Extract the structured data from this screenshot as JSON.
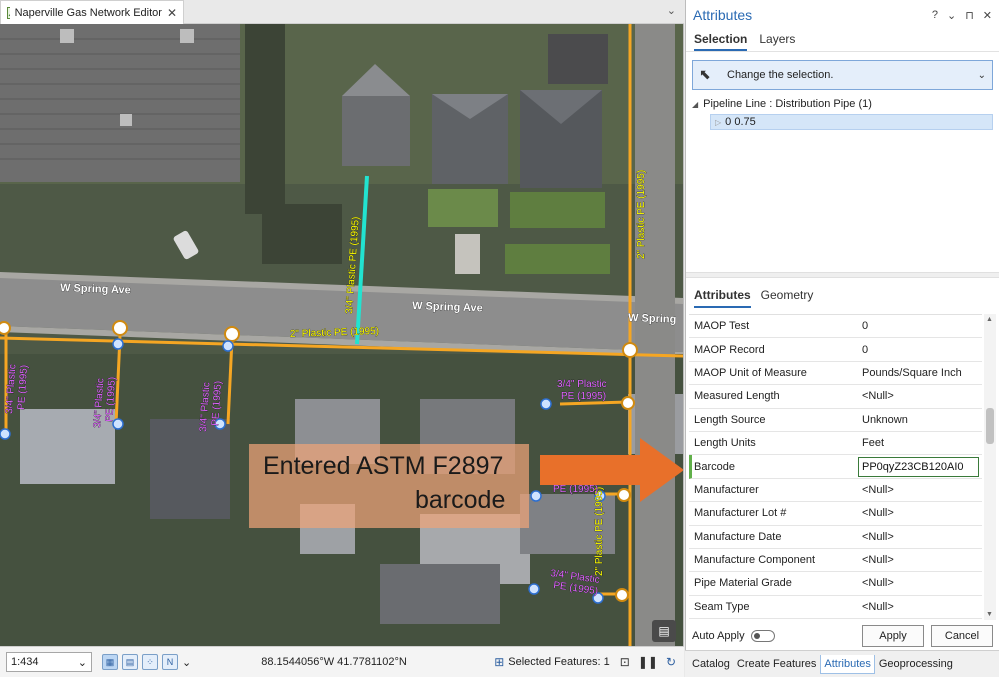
{
  "map_tab": {
    "title": "Naperville Gas Network Editor",
    "close": "✕"
  },
  "map": {
    "streets": [
      "W Spring Ave",
      "W Spring Ave",
      "W Spring"
    ],
    "pipe_labels": {
      "main_horizontal": "2\" Plastic PE (1995)",
      "main_vertical": "2\" Plastic PE (1995)",
      "main_vertical_lower": "2\" Plastic PE (1995)",
      "highlighted": "3/4\" Plastic PE (1995)",
      "service_a1": "3/4\" Plastic",
      "service_a2": "PE (1995)",
      "service_b1": "3/4\" Plastic",
      "service_b2": "PE (1995)",
      "service_c1": "3/4\" Plastic",
      "service_c2": "PE (1995)",
      "service_d1": "3/4\" Plastic",
      "service_d2": "PE (1995)",
      "service_e": "PE (1995)",
      "service_f1": "3/4\" Plastic",
      "service_f2": "PE (1995)"
    },
    "annotation": {
      "line1": "Entered ASTM F2897",
      "line2": "barcode"
    },
    "float_button_icon": "comment-icon"
  },
  "map_status": {
    "scale": "1:434",
    "coordinates": "88.1544056°W 41.7781102°N",
    "selected_features": "Selected Features: 1"
  },
  "pane": {
    "title": "Attributes",
    "controls": [
      "?",
      "⌄",
      "⊓",
      "✕"
    ],
    "tabs": [
      "Selection",
      "Layers"
    ],
    "change_selection": "Change the selection.",
    "tree": {
      "layer": "Pipeline Line : Distribution Pipe (1)",
      "feature": "0 0.75"
    },
    "lower_tabs": [
      "Attributes",
      "Geometry"
    ],
    "rows": [
      {
        "name": "MAOP Test",
        "value": "0"
      },
      {
        "name": "MAOP Record",
        "value": "0"
      },
      {
        "name": "MAOP Unit of Measure",
        "value": "Pounds/Square Inch"
      },
      {
        "name": "Measured Length",
        "value": "<Null>"
      },
      {
        "name": "Length Source",
        "value": "Unknown"
      },
      {
        "name": "Length Units",
        "value": "Feet"
      },
      {
        "name": "Barcode",
        "value": "PP0qyZ23CB120AI0"
      },
      {
        "name": "Manufacturer",
        "value": "<Null>"
      },
      {
        "name": "Manufacturer Lot #",
        "value": "<Null>"
      },
      {
        "name": "Manufacture Date",
        "value": "<Null>"
      },
      {
        "name": "Manufacture Component",
        "value": "<Null>"
      },
      {
        "name": "Pipe Material Grade",
        "value": "<Null>"
      },
      {
        "name": "Seam Type",
        "value": "<Null>"
      }
    ],
    "auto_apply": "Auto Apply",
    "apply": "Apply",
    "cancel": "Cancel"
  },
  "dock_tabs": [
    "Catalog",
    "Create Features",
    "Attributes",
    "Geoprocessing"
  ],
  "colors": {
    "accent": "#2a6ab3",
    "pipe": "#f5a623",
    "highlight": "#22e3d0",
    "label_main": "#ffff00",
    "label_service": "#e066ff",
    "arrow": "#e8702a"
  }
}
